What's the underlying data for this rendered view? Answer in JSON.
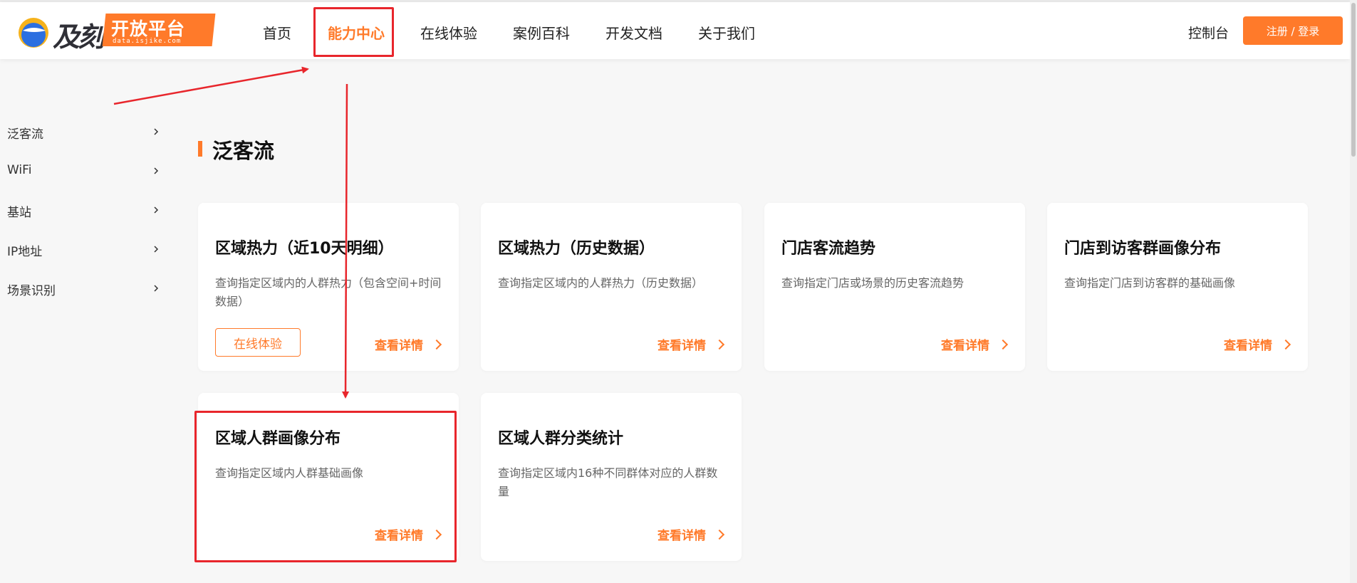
{
  "header": {
    "logo": {
      "brand": "及刻",
      "tag_title": "开放平台",
      "tag_domain": "data.isjike.com"
    },
    "nav": [
      {
        "label": "首页"
      },
      {
        "label": "能力中心",
        "active": true
      },
      {
        "label": "在线体验"
      },
      {
        "label": "案例百科"
      },
      {
        "label": "开发文档"
      },
      {
        "label": "关于我们"
      }
    ],
    "console_label": "控制台",
    "auth_label": "注册 / 登录"
  },
  "sidebar": {
    "items": [
      {
        "label": "泛客流"
      },
      {
        "label": "WiFi"
      },
      {
        "label": "基站"
      },
      {
        "label": "IP地址"
      },
      {
        "label": "场景识别"
      }
    ]
  },
  "section": {
    "title": "泛客流",
    "cards": [
      {
        "title": "区域热力（近10天明细）",
        "desc": "查询指定区域内的人群热力（包含空间+时间数据）",
        "try_label": "在线体验",
        "detail_label": "查看详情"
      },
      {
        "title": "区域热力（历史数据）",
        "desc": "查询指定区域内的人群热力（历史数据）",
        "detail_label": "查看详情"
      },
      {
        "title": "门店客流趋势",
        "desc": "查询指定门店或场景的历史客流趋势",
        "detail_label": "查看详情"
      },
      {
        "title": "门店到访客群画像分布",
        "desc": "查询指定门店到访客群的基础画像",
        "detail_label": "查看详情"
      },
      {
        "title": "区域人群画像分布",
        "desc": "查询指定区域内人群基础画像",
        "detail_label": "查看详情"
      },
      {
        "title": "区域人群分类统计",
        "desc": "查询指定区域内16种不同群体对应的人群数量",
        "detail_label": "查看详情"
      }
    ]
  },
  "colors": {
    "accent": "#ff7a2a",
    "annotation": "#e8262c",
    "background": "#f7f7f7"
  }
}
